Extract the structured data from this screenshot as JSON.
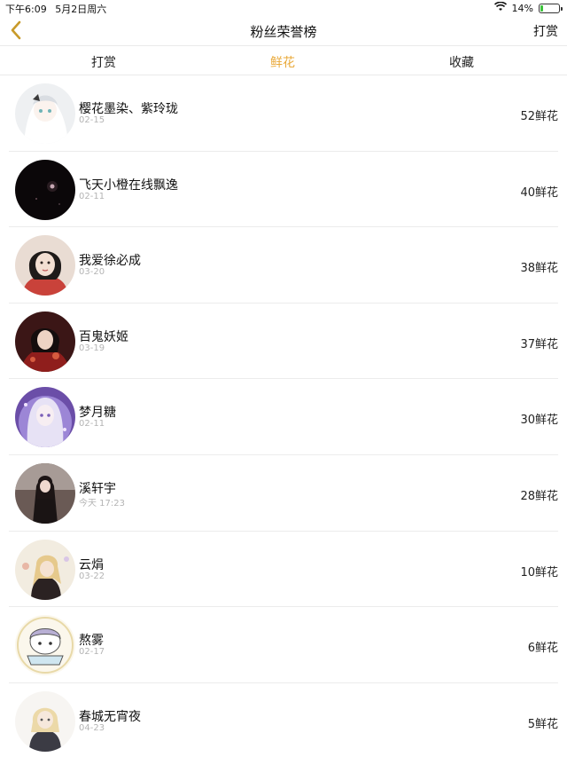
{
  "status": {
    "time": "下午6:09",
    "date": "5月2日周六",
    "battery_percent": "14%",
    "battery_level": 0.14
  },
  "nav": {
    "title": "粉丝荣誉榜",
    "right_label": "打赏"
  },
  "tabs": [
    {
      "label": "打赏",
      "active": false
    },
    {
      "label": "鲜花",
      "active": true
    },
    {
      "label": "收藏",
      "active": false
    }
  ],
  "colors": {
    "accent": "#e9a93a",
    "back_icon": "#c89a2a"
  },
  "fans": [
    {
      "name": "樱花墨染、紫玲珑",
      "date": "02-15",
      "count": "52鲜花"
    },
    {
      "name": "飞天小橙在线飘逸",
      "date": "02-11",
      "count": "40鲜花"
    },
    {
      "name": "我爱徐必成",
      "date": "03-20",
      "count": "38鲜花"
    },
    {
      "name": "百鬼妖姬",
      "date": "03-19",
      "count": "37鲜花"
    },
    {
      "name": "梦月糖",
      "date": "02-11",
      "count": "30鲜花"
    },
    {
      "name": "溪轩宇",
      "date": "今天 17:23",
      "count": "28鲜花"
    },
    {
      "name": "云焆",
      "date": "03-22",
      "count": "10鲜花"
    },
    {
      "name": "熬雾",
      "date": "02-17",
      "count": "6鲜花"
    },
    {
      "name": "春城无宵夜",
      "date": "04-23",
      "count": "5鲜花"
    }
  ]
}
